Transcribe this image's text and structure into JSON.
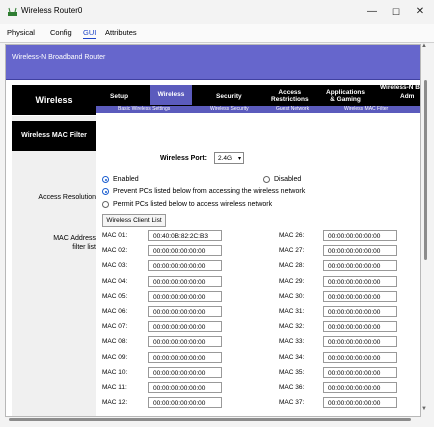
{
  "window": {
    "title": "Wireless Router0",
    "min": "—",
    "max": "☐",
    "close": "✕"
  },
  "tabs": [
    {
      "label": "Physical"
    },
    {
      "label": "Config"
    },
    {
      "label": "GUI"
    },
    {
      "label": "Attributes"
    }
  ],
  "router": {
    "name": "Wireless-N Broadband Router",
    "model": "Wireless-N B",
    "section": "Wireless",
    "nav": [
      {
        "label": "Setup"
      },
      {
        "label": "Wireless"
      },
      {
        "label": "Security"
      },
      {
        "label": "Access\nRestrictions"
      },
      {
        "label": "Applications\n& Gaming"
      },
      {
        "label": "Adm"
      }
    ],
    "subnav": [
      {
        "label": "Basic Wireless Settings"
      },
      {
        "label": "Wireless Security"
      },
      {
        "label": "Guest Network"
      },
      {
        "label": "Wireless MAC Filter"
      }
    ]
  },
  "sidebar": {
    "heading": "Wireless MAC Filter",
    "access_label": "Access Resolution",
    "mac_label": "MAC Address filter list"
  },
  "filter": {
    "port_label": "Wireless Port:",
    "port_value": "2.4G",
    "enabled": "Enabled",
    "disabled": "Disabled",
    "prevent": "Prevent PCs listed below from accessing the wireless network",
    "permit": "Permit PCs listed below to access wireless network",
    "client_list": "Wireless Client List"
  },
  "mac_left": [
    {
      "label": "MAC 01:",
      "value": "00:40:0B:82:2C:B3"
    },
    {
      "label": "MAC 02:",
      "value": "00:00:00:00:00:00"
    },
    {
      "label": "MAC 03:",
      "value": "00:00:00:00:00:00"
    },
    {
      "label": "MAC 04:",
      "value": "00:00:00:00:00:00"
    },
    {
      "label": "MAC 05:",
      "value": "00:00:00:00:00:00"
    },
    {
      "label": "MAC 06:",
      "value": "00:00:00:00:00:00"
    },
    {
      "label": "MAC 07:",
      "value": "00:00:00:00:00:00"
    },
    {
      "label": "MAC 08:",
      "value": "00:00:00:00:00:00"
    },
    {
      "label": "MAC 09:",
      "value": "00:00:00:00:00:00"
    },
    {
      "label": "MAC 10:",
      "value": "00:00:00:00:00:00"
    },
    {
      "label": "MAC 11:",
      "value": "00:00:00:00:00:00"
    },
    {
      "label": "MAC 12:",
      "value": "00:00:00:00:00:00"
    }
  ],
  "mac_right": [
    {
      "label": "MAC 26:",
      "value": "00:00:00:00:00:00"
    },
    {
      "label": "MAC 27:",
      "value": "00:00:00:00:00:00"
    },
    {
      "label": "MAC 28:",
      "value": "00:00:00:00:00:00"
    },
    {
      "label": "MAC 29:",
      "value": "00:00:00:00:00:00"
    },
    {
      "label": "MAC 30:",
      "value": "00:00:00:00:00:00"
    },
    {
      "label": "MAC 31:",
      "value": "00:00:00:00:00:00"
    },
    {
      "label": "MAC 32:",
      "value": "00:00:00:00:00:00"
    },
    {
      "label": "MAC 33:",
      "value": "00:00:00:00:00:00"
    },
    {
      "label": "MAC 34:",
      "value": "00:00:00:00:00:00"
    },
    {
      "label": "MAC 35:",
      "value": "00:00:00:00:00:00"
    },
    {
      "label": "MAC 36:",
      "value": "00:00:00:00:00:00"
    },
    {
      "label": "MAC 37:",
      "value": "00:00:00:00:00:00"
    }
  ]
}
